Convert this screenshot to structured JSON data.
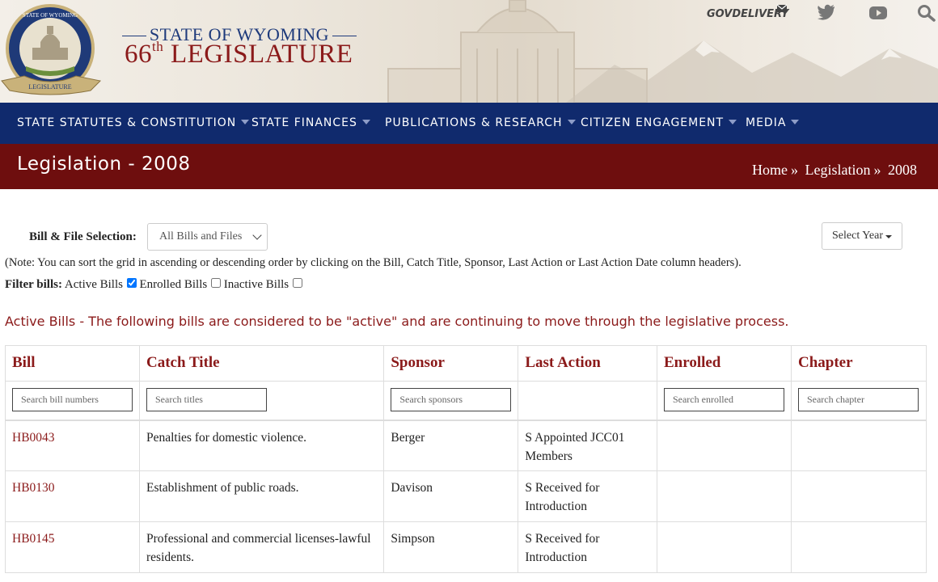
{
  "header": {
    "title_line1": "STATE OF WYOMING",
    "title_ordinal": "66",
    "title_ordinal_suffix": "th",
    "title_line2": "LEGISLATURE",
    "seal_text_top": "STATE OF WYOMING",
    "seal_text_bottom": "LEGISLATURE",
    "govdelivery_label": "GOVDELIVERY",
    "icons": [
      "mail-icon",
      "twitter-icon",
      "youtube-icon",
      "search-icon"
    ]
  },
  "nav": {
    "items": [
      {
        "label": "STATE STATUTES & CONSTITUTION"
      },
      {
        "label": "STATE FINANCES"
      },
      {
        "label": "PUBLICATIONS & RESEARCH"
      },
      {
        "label": "CITIZEN ENGAGEMENT"
      },
      {
        "label": "MEDIA"
      }
    ]
  },
  "banner": {
    "page_title": "Legislation - 2008",
    "breadcrumb": [
      "Home",
      "Legislation",
      "2008"
    ],
    "separator": "»"
  },
  "filters": {
    "bfs_label": "Bill & File Selection:",
    "bfs_value": "All Bills and Files",
    "year_button": "Select Year",
    "note": "(Note: You can sort the grid in ascending or descending order by clicking on the Bill, Catch Title, Sponsor, Last Action or Last Action Date column headers).",
    "filter_label": "Filter bills:",
    "options": [
      {
        "label": "Active Bills",
        "checked": true
      },
      {
        "label": "Enrolled Bills",
        "checked": false
      },
      {
        "label": "Inactive Bills",
        "checked": false
      }
    ]
  },
  "section_title": "Active Bills - The following bills are considered to be \"active\" and are continuing to move through the legislative process.",
  "table": {
    "columns": [
      "Bill",
      "Catch Title",
      "Sponsor",
      "Last Action",
      "Enrolled",
      "Chapter"
    ],
    "search_placeholders": {
      "bill": "Search bill numbers",
      "title": "Search titles",
      "sponsor": "Search sponsors",
      "enrolled": "Search enrolled",
      "chapter": "Search chapter"
    },
    "rows": [
      {
        "bill": "HB0043",
        "title": "Penalties for domestic violence.",
        "sponsor": "Berger",
        "last_action": "S Appointed JCC01 Members",
        "enrolled": "",
        "chapter": ""
      },
      {
        "bill": "HB0130",
        "title": "Establishment of public roads.",
        "sponsor": "Davison",
        "last_action": "S Received for Introduction",
        "enrolled": "",
        "chapter": ""
      },
      {
        "bill": "HB0145",
        "title": "Professional and commercial licenses-lawful residents.",
        "sponsor": "Simpson",
        "last_action": "S Received for Introduction",
        "enrolled": "",
        "chapter": ""
      }
    ]
  },
  "colors": {
    "nav_bg": "#102a6d",
    "banner_bg": "#6e0e0e",
    "accent_red": "#8b1a1a",
    "title_blue": "#1e3a7b"
  }
}
